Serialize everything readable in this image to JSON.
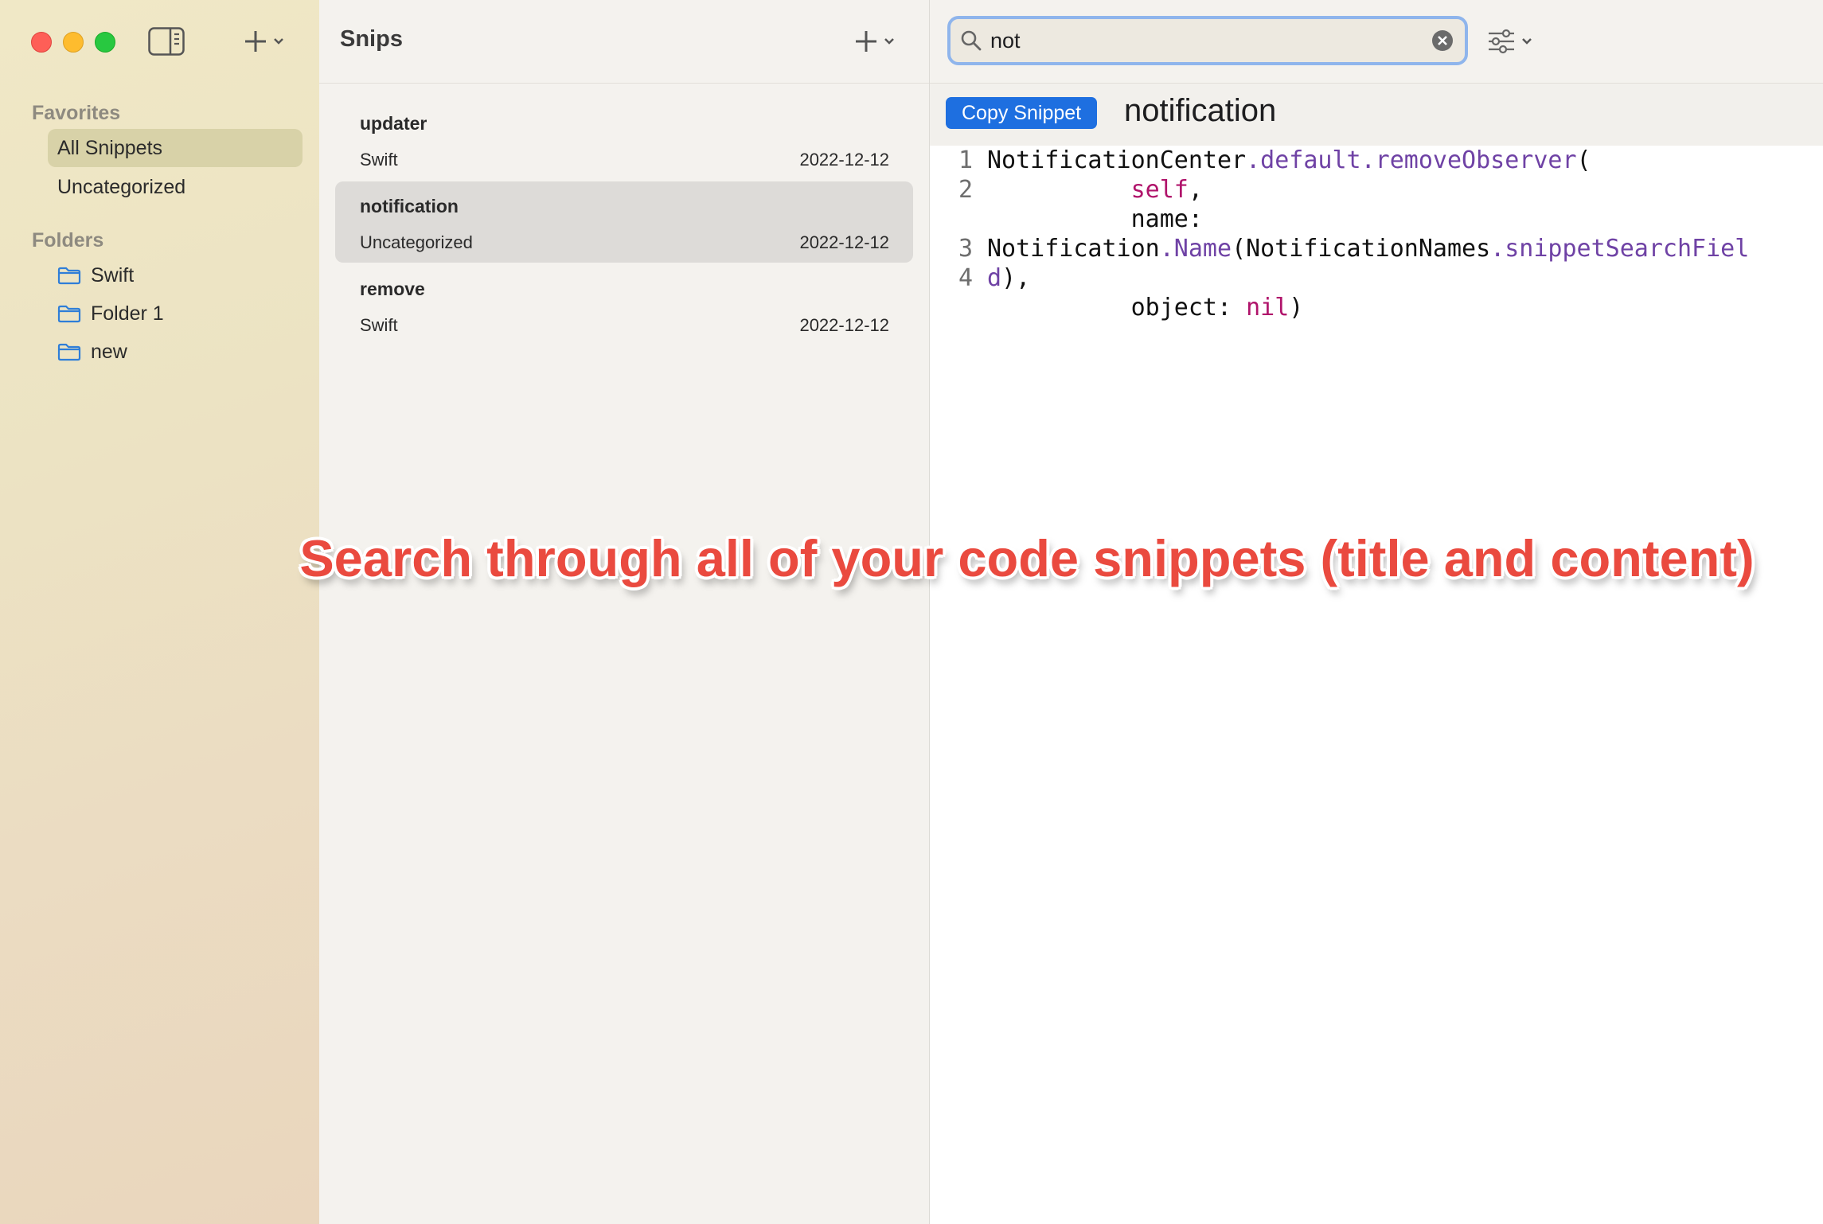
{
  "sidebar": {
    "favorites_header": "Favorites",
    "favorites": [
      {
        "label": "All Snippets",
        "selected": true
      },
      {
        "label": "Uncategorized",
        "selected": false
      }
    ],
    "folders_header": "Folders",
    "folders": [
      {
        "label": "Swift",
        "icon": "folder-icon"
      },
      {
        "label": "Folder 1",
        "icon": "folder-icon"
      },
      {
        "label": "new",
        "icon": "folder-icon"
      }
    ]
  },
  "list": {
    "title": "Snips",
    "items": [
      {
        "title": "updater",
        "folder": "Swift",
        "date": "2022-12-12",
        "selected": false
      },
      {
        "title": "notification",
        "folder": "Uncategorized",
        "date": "2022-12-12",
        "selected": true
      },
      {
        "title": "remove",
        "folder": "Swift",
        "date": "2022-12-12",
        "selected": false
      }
    ]
  },
  "search": {
    "value": "not",
    "placeholder": ""
  },
  "detail": {
    "copy_label": "Copy Snippet",
    "title": "notification",
    "line_numbers": [
      "1",
      "2",
      "3",
      "4"
    ],
    "code": {
      "l1_obj": "NotificationCenter",
      "l1_member": ".default.removeObserver",
      "l1_paren": "(",
      "l2_indent": "          ",
      "l2_kw": "self",
      "l2_comma": ",",
      "l3_text": "          name:",
      "l4_type": "Notification",
      "l4_member": ".Name",
      "l4_arg": "(NotificationNames",
      "l4_prop": ".snippetSearchFiel",
      "l5_prop": "d",
      "l5_rest": "),",
      "l6_text": "          object: ",
      "l6_kw": "nil",
      "l6_close": ")"
    }
  },
  "caption": "Search through all of your code snippets (title and content)",
  "colors": {
    "accent": "#1e6fe0",
    "search_focus": "#8fb5ec",
    "caption": "#ea4a3f",
    "keyword": "#b0146b",
    "member": "#6f42a5",
    "traffic_red": "#fe5f57",
    "traffic_yellow": "#febc2e",
    "traffic_green": "#28c840"
  }
}
